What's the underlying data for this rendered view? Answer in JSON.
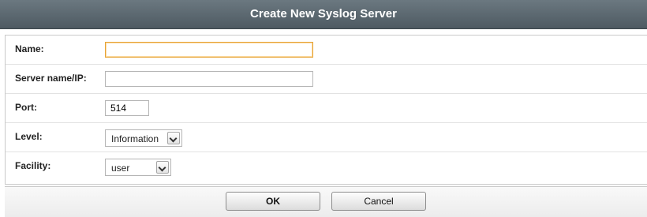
{
  "dialog": {
    "title": "Create New Syslog Server",
    "fields": {
      "name": {
        "label": "Name:",
        "value": ""
      },
      "server": {
        "label": "Server name/IP:",
        "value": ""
      },
      "port": {
        "label": "Port:",
        "value": "514"
      },
      "level": {
        "label": "Level:",
        "selected": "Information"
      },
      "facility": {
        "label": "Facility:",
        "selected": "user"
      }
    },
    "buttons": {
      "ok": "OK",
      "cancel": "Cancel"
    }
  },
  "colors": {
    "titlebar": "#56626a",
    "focus_border": "#e6a335"
  },
  "icons": {
    "dropdown": "chevron-down-icon"
  }
}
